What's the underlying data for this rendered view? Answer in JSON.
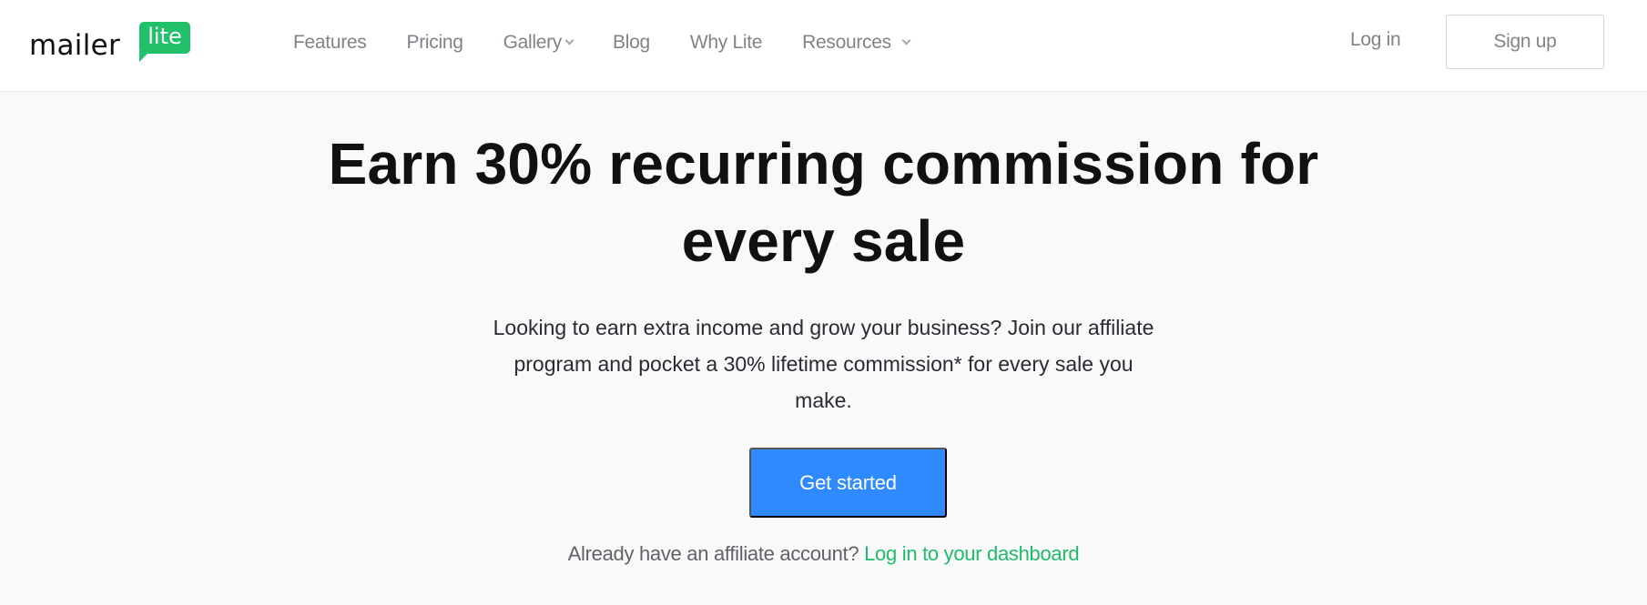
{
  "brand": {
    "name_main": "mailer",
    "name_badge": "lite",
    "brand_color": "#22c06b"
  },
  "nav": {
    "items": [
      {
        "label": "Features",
        "has_dropdown": false
      },
      {
        "label": "Pricing",
        "has_dropdown": false
      },
      {
        "label": "Gallery",
        "has_dropdown": true,
        "icon": "chevron-down-icon"
      },
      {
        "label": "Blog",
        "has_dropdown": false
      },
      {
        "label": "Why Lite",
        "has_dropdown": false
      },
      {
        "label": "Resources",
        "has_dropdown": true,
        "icon": "chevron-down-icon"
      }
    ],
    "login_label": "Log in",
    "signup_label": "Sign up"
  },
  "hero": {
    "title_lines": [
      "Earn 30% recurring commission for",
      "every sale"
    ],
    "description_lines": [
      "Looking to earn extra income and grow your business? Join our affiliate",
      "program and pocket a 30% lifetime commission* for every sale you",
      "make."
    ],
    "cta_label": "Get started",
    "cta_color": "#2f8bfd"
  },
  "footer": {
    "prompt": "Already have an affiliate account?",
    "link_label": "Log in to your dashboard",
    "link_color": "#1fbc6c"
  }
}
